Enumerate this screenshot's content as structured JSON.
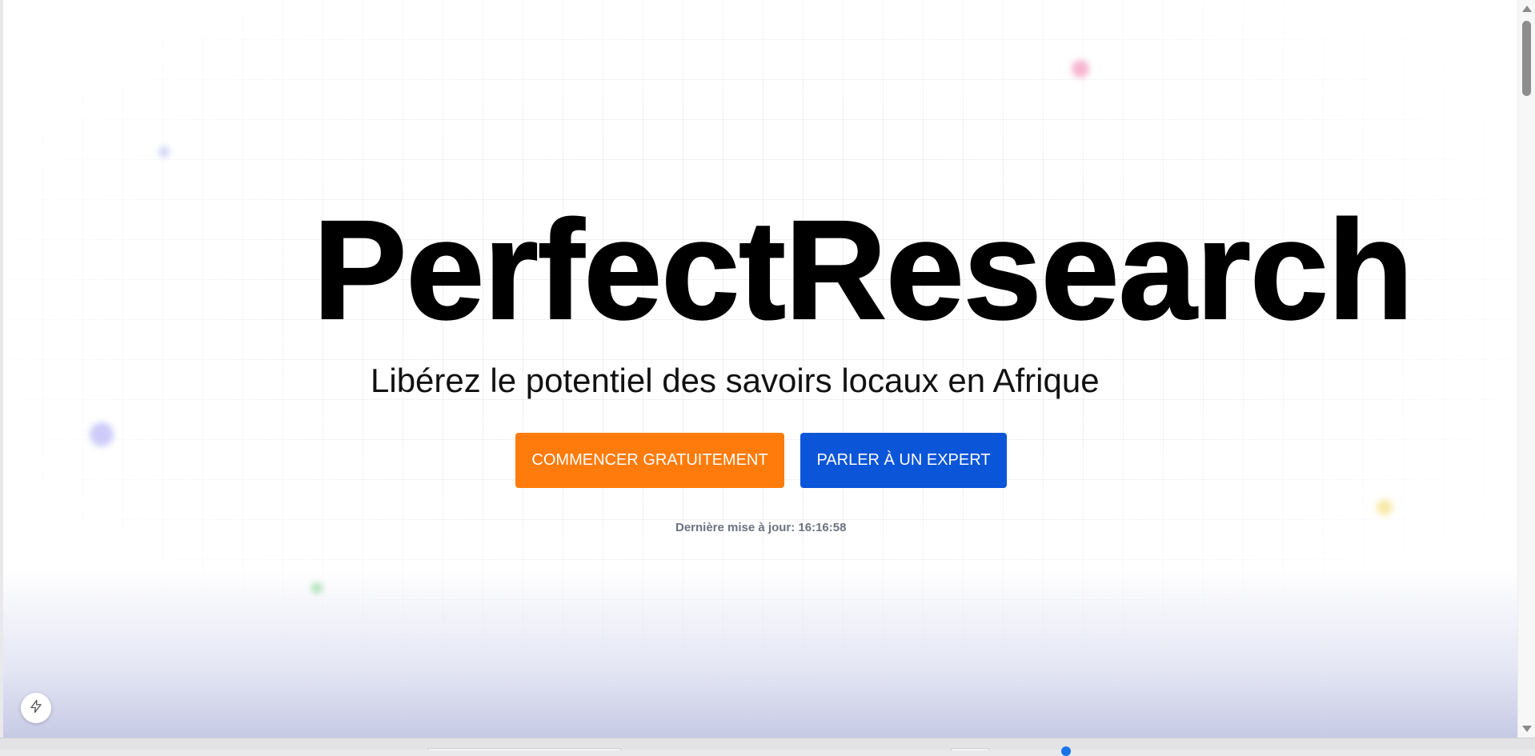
{
  "hero": {
    "title": "PerfectResearch",
    "subtitle": "Libérez le potentiel des savoirs locaux en Afrique"
  },
  "actions": {
    "primary_label": "COMMENCER GRATUITEMENT",
    "secondary_label": "PARLER À UN EXPERT"
  },
  "status": {
    "last_update": "Dernière mise à jour: 16:16:58"
  },
  "floating_button": {
    "icon": "lightning-icon"
  },
  "colors": {
    "primary": "#ff7b0b",
    "secondary": "#0b55d9",
    "title": "#000000",
    "muted": "#6b7280"
  }
}
